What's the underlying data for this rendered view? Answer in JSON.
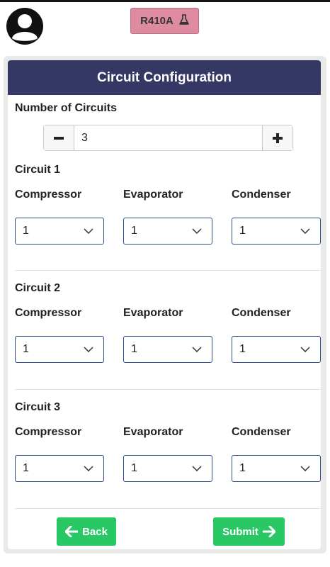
{
  "header": {
    "refrigerant_label": "R410A",
    "refrigerant_icon": "flask-icon",
    "avatar_icon": "user-avatar-icon"
  },
  "card": {
    "title": "Circuit Configuration",
    "number_of_circuits_label": "Number of Circuits",
    "number_of_circuits_value": "3"
  },
  "circuits": [
    {
      "title": "Circuit 1",
      "compressor_label": "Compressor",
      "compressor_value": "1",
      "evaporator_label": "Evaporator",
      "evaporator_value": "1",
      "condenser_label": "Condenser",
      "condenser_value": "1"
    },
    {
      "title": "Circuit 2",
      "compressor_label": "Compressor",
      "compressor_value": "1",
      "evaporator_label": "Evaporator",
      "evaporator_value": "1",
      "condenser_label": "Condenser",
      "condenser_value": "1"
    },
    {
      "title": "Circuit 3",
      "compressor_label": "Compressor",
      "compressor_value": "1",
      "evaporator_label": "Evaporator",
      "evaporator_value": "1",
      "condenser_label": "Condenser",
      "condenser_value": "1"
    }
  ],
  "actions": {
    "back_label": "Back",
    "submit_label": "Submit"
  },
  "colors": {
    "header_bg": "#353765",
    "refrigerant_badge": "#de8ba1",
    "button_green": "#28c964",
    "select_border": "#2d4e8c"
  }
}
